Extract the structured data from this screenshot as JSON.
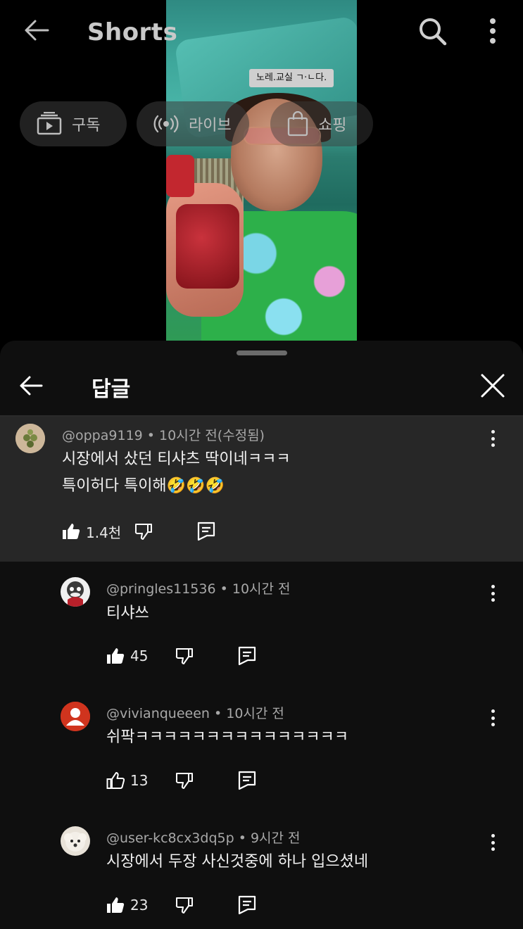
{
  "header": {
    "title": "Shorts",
    "chips": [
      {
        "label": "구독",
        "icon": "subscriptions-icon"
      },
      {
        "label": "라이브",
        "icon": "live-icon"
      },
      {
        "label": "쇼핑",
        "icon": "shopping-bag-icon"
      }
    ]
  },
  "video": {
    "caption": "노레.교실 ㄱ·ㄴ다."
  },
  "sheet": {
    "title": "답글"
  },
  "parent_comment": {
    "author": "@oppa9119",
    "time": "10시간 전(수정됨)",
    "lines": [
      "시장에서 샀던 티샤츠 딱이네ㅋㅋㅋ",
      "특이허다 특이해🤣🤣🤣"
    ],
    "likes": "1.4천"
  },
  "replies": [
    {
      "author": "@pringles11536",
      "time": "10시간 전",
      "text": "티샤쓰",
      "likes": "45",
      "liked": true
    },
    {
      "author": "@vivianqueeen",
      "time": "10시간 전",
      "text": "쉬팍ㅋㅋㅋㅋㅋㅋㅋㅋㅋㅋㅋㅋㅋㅋㅋ",
      "likes": "13",
      "liked": false
    },
    {
      "author": "@user-kc8cx3dq5p",
      "time": "9시간 전",
      "text": "시장에서 두장 사신것중에 하나 입으셨네",
      "likes": "23",
      "liked": true
    }
  ],
  "separator": " • "
}
